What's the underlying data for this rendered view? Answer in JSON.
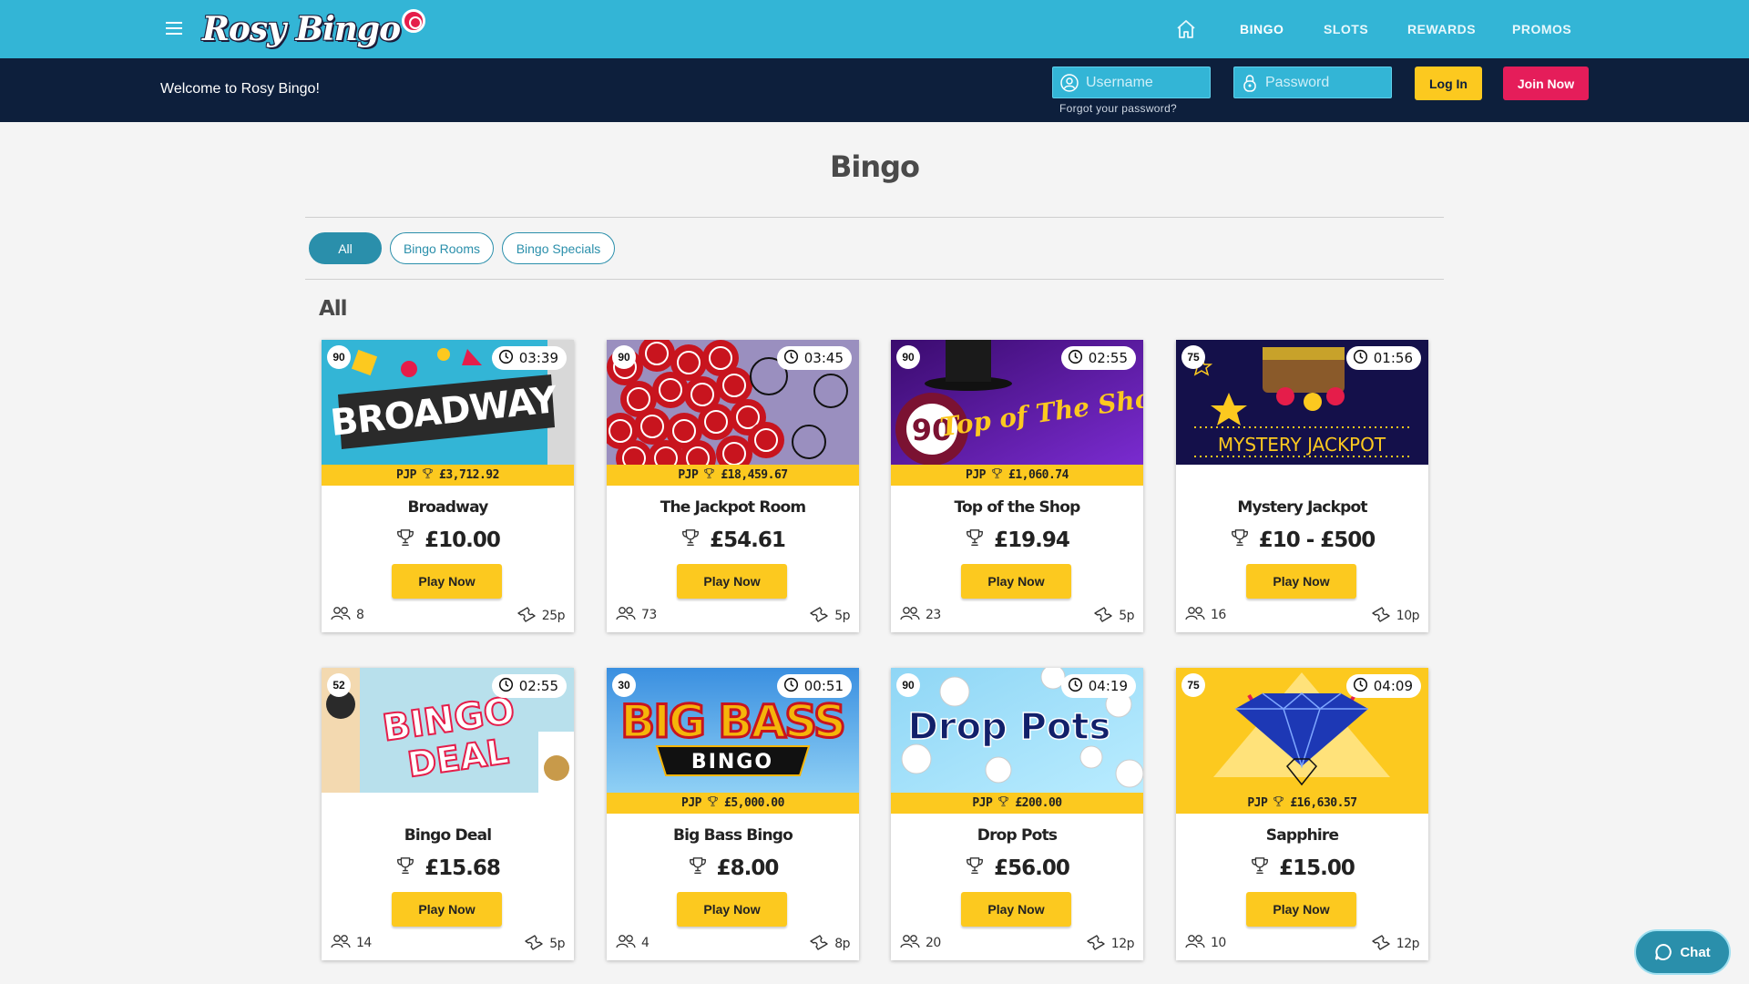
{
  "header": {
    "logo_text": "Rosy Bingo",
    "nav": [
      "BINGO",
      "SLOTS",
      "REWARDS",
      "PROMOS"
    ],
    "active_nav": "BINGO",
    "icons": [
      "menu-icon",
      "home-icon"
    ]
  },
  "subbar": {
    "welcome": "Welcome to Rosy Bingo!",
    "username_placeholder": "Username",
    "password_placeholder": "Password",
    "forgot": "Forgot your password?",
    "login": "Log In",
    "join": "Join Now"
  },
  "main": {
    "title": "Bingo",
    "filters": [
      "All",
      "Bingo Rooms",
      "Bingo Specials"
    ],
    "active_filter": "All",
    "section_title": "All",
    "play_label": "Play Now",
    "pjp_label": "PJP"
  },
  "cards": [
    {
      "name": "Broadway",
      "balls": "90",
      "timer": "03:39",
      "pjp": "£3,712.92",
      "prize": "£10.00",
      "players": "8",
      "ticket": "25p",
      "theme": "broadway"
    },
    {
      "name": "The Jackpot Room",
      "balls": "90",
      "timer": "03:45",
      "pjp": "£18,459.67",
      "prize": "£54.61",
      "players": "73",
      "ticket": "5p",
      "theme": "jackpot-room"
    },
    {
      "name": "Top of the Shop",
      "balls": "90",
      "timer": "02:55",
      "pjp": "£1,060.74",
      "prize": "£19.94",
      "players": "23",
      "ticket": "5p",
      "theme": "top-shop",
      "img_text": "Top of The Shop",
      "ball_text": "90"
    },
    {
      "name": "Mystery Jackpot",
      "balls": "75",
      "timer": "01:56",
      "pjp": "",
      "prize": "£10 - £500",
      "players": "16",
      "ticket": "10p",
      "theme": "mystery",
      "img_text": "MYSTERY JACKPOT"
    },
    {
      "name": "Bingo Deal",
      "balls": "52",
      "timer": "02:55",
      "pjp": "",
      "prize": "£15.68",
      "players": "14",
      "ticket": "5p",
      "theme": "bingo-deal",
      "img_text": "BINGO DEAL"
    },
    {
      "name": "Big Bass Bingo",
      "balls": "30",
      "timer": "00:51",
      "pjp": "£5,000.00",
      "prize": "£8.00",
      "players": "4",
      "ticket": "8p",
      "theme": "big-bass",
      "img_text": "BIG BASS",
      "img_sub": "BINGO"
    },
    {
      "name": "Drop Pots",
      "balls": "90",
      "timer": "04:19",
      "pjp": "£200.00",
      "prize": "£56.00",
      "players": "20",
      "ticket": "12p",
      "theme": "drop-pots",
      "img_text": "Drop Pots"
    },
    {
      "name": "Sapphire",
      "balls": "75",
      "timer": "04:09",
      "pjp": "£16,630.57",
      "prize": "£15.00",
      "players": "10",
      "ticket": "12p",
      "theme": "sapphire"
    }
  ],
  "chat": "Chat",
  "colors": {
    "header": "#33b5d6",
    "subbar": "#0d1f3c",
    "accent_yellow": "#fcc91f",
    "join_pink": "#e51d5a",
    "filter_teal": "#2a8fab"
  }
}
